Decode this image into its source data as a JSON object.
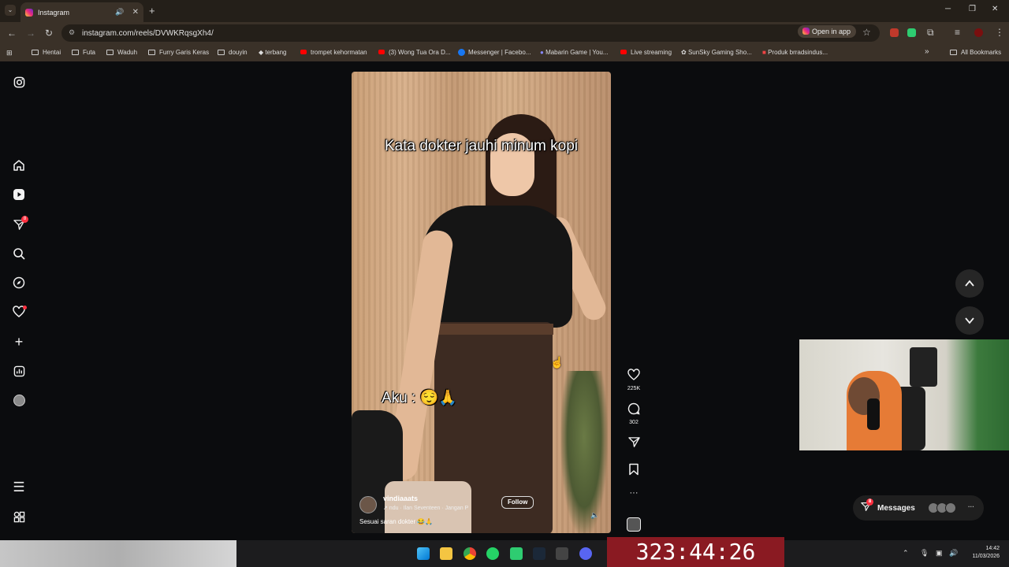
{
  "browser": {
    "tab": {
      "title": "Instagram",
      "tab_list_icon": "chevron-down-icon",
      "mute_icon": "speaker-icon",
      "close": "✕"
    },
    "new_tab": "+",
    "window_controls": {
      "minimize": "─",
      "restore": "❐",
      "close": "✕"
    },
    "url": "instagram.com/reels/DVWKRqsgXh4/",
    "open_in_app": "Open in app",
    "bookmarks": [
      {
        "label": "Hentai",
        "icon": "folder-icon"
      },
      {
        "label": "Futa",
        "icon": "folder-icon"
      },
      {
        "label": "Waduh",
        "icon": "folder-icon"
      },
      {
        "label": "Furry Garis Keras",
        "icon": "folder-icon"
      },
      {
        "label": "douyin",
        "icon": "folder-icon"
      },
      {
        "label": "terbang",
        "icon": "page-icon"
      },
      {
        "label": "trompet kehormatan",
        "icon": "youtube-icon"
      },
      {
        "label": "(3) Wong Tua Ora D...",
        "icon": "youtube-icon"
      },
      {
        "label": "Messenger | Facebo...",
        "icon": "facebook-icon"
      },
      {
        "label": "Mabarin Game | You...",
        "icon": "page-icon"
      },
      {
        "label": "Live streaming",
        "icon": "youtube-icon"
      },
      {
        "label": "SunSky Gaming Sho...",
        "icon": "page-icon"
      },
      {
        "label": "Produk brradsindus...",
        "icon": "page-icon"
      }
    ],
    "bookmarks_more": "»",
    "all_bookmarks": "All Bookmarks"
  },
  "sidebar": {
    "logo_icon": "instagram-icon",
    "items": [
      {
        "name": "home",
        "icon": "home-icon"
      },
      {
        "name": "reels",
        "icon": "reels-icon"
      },
      {
        "name": "messages",
        "icon": "send-icon",
        "badge": "8"
      },
      {
        "name": "search",
        "icon": "search-icon"
      },
      {
        "name": "explore",
        "icon": "compass-icon"
      },
      {
        "name": "notifications",
        "icon": "heart-icon"
      },
      {
        "name": "create",
        "icon": "plus-icon"
      },
      {
        "name": "dashboard",
        "icon": "chart-icon"
      },
      {
        "name": "profile",
        "icon": "avatar-icon"
      }
    ],
    "more_icon": "menu-icon",
    "also_from_meta_icon": "grid-icon"
  },
  "reel": {
    "caption_top": "Kata dokter jauhi minum kopi",
    "caption_bottom": "Aku : 😌🙏",
    "username": "vindiaaats",
    "music": "↗ ndu · Ilan Seventeen · Jangan P",
    "follow": "Follow",
    "description": "Sesuai saran dokter 😂🙏",
    "volume_icon": "speaker-icon"
  },
  "actions": {
    "like_count": "225K",
    "comment_count": "302",
    "more": "···"
  },
  "nav": {
    "up": "⌃",
    "down": "⌄"
  },
  "messages_pill": {
    "label": "Messages",
    "badge": "8",
    "more": "···"
  },
  "taskbar": {
    "timer": "323:44:26",
    "time": "14:42",
    "date": "11/03/2026"
  }
}
